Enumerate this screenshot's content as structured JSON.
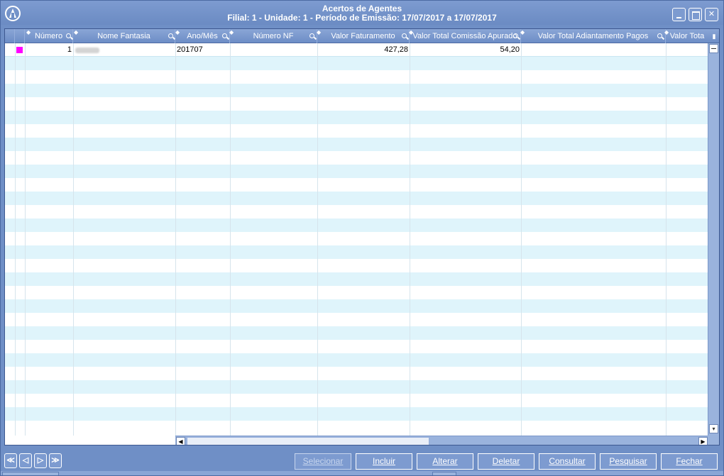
{
  "window": {
    "title": "Acertos de Agentes",
    "subtitle": "Filial: 1 - Unidade: 1 - Período de Emissão: 17/07/2017 a 17/07/2017",
    "close_glyph": "✕"
  },
  "colors": {
    "marker": "#ff00ff",
    "row_alt": "#dff4fb",
    "header": "#7d9bd0"
  },
  "grid": {
    "columns": [
      {
        "label": "Número"
      },
      {
        "label": "Nome Fantasia"
      },
      {
        "label": "Ano/Mês"
      },
      {
        "label": "Número NF"
      },
      {
        "label": "Valor Faturamento"
      },
      {
        "label": "Valor Total Comissão Apurado"
      },
      {
        "label": "Valor Total Adiantamento Pagos"
      },
      {
        "label": "Valor Tota"
      }
    ],
    "rows": [
      {
        "numero": "1",
        "nome_fantasia": "",
        "ano_mes": "201707",
        "numero_nf": "",
        "valor_faturamento": "427,28",
        "valor_comissao": "54,20",
        "valor_adiantamento": "",
        "valor_total": ""
      }
    ],
    "empty_row_count": 28
  },
  "navigation": {
    "first": "≪",
    "prev": "◁",
    "next": "▷",
    "last": "≫"
  },
  "actions": {
    "selecionar": "Selecionar",
    "incluir": "Incluir",
    "alterar": "Alterar",
    "deletar": "Deletar",
    "consultar": "Consultar",
    "pesquisar": "Pesquisar",
    "fechar": "Fechar"
  }
}
